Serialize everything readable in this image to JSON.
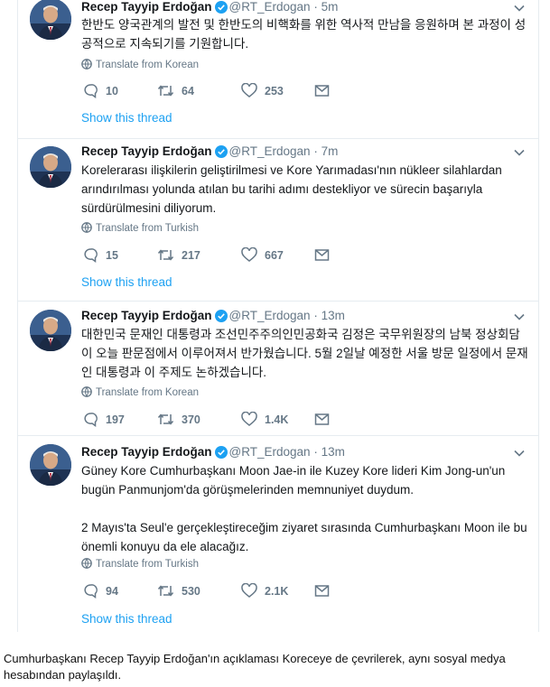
{
  "tweets": [
    {
      "name": "Recep Tayyip Erdoğan",
      "handle": "@RT_Erdogan",
      "separator": "·",
      "time": "5m",
      "paragraphs": [
        "한반도 양국관계의 발전 및 한반도의 비핵화를 위한 역사적 만남을 응원하며 본 과정이 성공적으로 지속되기를 기원합니다."
      ],
      "translate": "Translate from Korean",
      "replies": "10",
      "retweets": "64",
      "likes": "253",
      "show_thread": "Show this thread"
    },
    {
      "name": "Recep Tayyip Erdoğan",
      "handle": "@RT_Erdogan",
      "separator": "·",
      "time": "7m",
      "paragraphs": [
        "Korelerarası ilişkilerin geliştirilmesi ve Kore Yarımadası'nın nükleer silahlardan arındırılması yolunda atılan bu tarihi adımı destekliyor ve sürecin başarıyla sürdürülmesini diliyorum."
      ],
      "translate": "Translate from Turkish",
      "replies": "15",
      "retweets": "217",
      "likes": "667",
      "show_thread": "Show this thread"
    },
    {
      "name": "Recep Tayyip Erdoğan",
      "handle": "@RT_Erdogan",
      "separator": "·",
      "time": "13m",
      "paragraphs": [
        "대한민국 문재인 대통령과 조선민주주의인민공화국 김정은 국무위원장의 남북 정상회담이 오늘 판문점에서 이루어져서 반가웠습니다. 5월 2일날 예정한 서울 방문 일정에서 문재인 대통령과 이 주제도 논하겠습니다."
      ],
      "translate": "Translate from Korean",
      "replies": "197",
      "retweets": "370",
      "likes": "1.4K"
    },
    {
      "name": "Recep Tayyip Erdoğan",
      "handle": "@RT_Erdogan",
      "separator": "·",
      "time": "13m",
      "paragraphs": [
        "Güney Kore Cumhurbaşkanı Moon Jae-in ile Kuzey Kore lideri Kim Jong-un'un bugün Panmunjom'da görüşmelerinden memnuniyet duydum.",
        "2 Mayıs'ta Seul'e gerçekleştireceğim ziyaret sırasında Cumhurbaşkanı Moon ile bu önemli konuyu da ele alacağız."
      ],
      "translate": "Translate from Turkish",
      "replies": "94",
      "retweets": "530",
      "likes": "2.1K",
      "show_thread": "Show this thread"
    }
  ],
  "caption": "Cumhurbaşkanı Recep Tayyip  Erdoğan'ın açıklaması Koreceye de  çevrilerek, aynı sosyal medya hesabından paylaşıldı.",
  "colors": {
    "link": "#1da1f2",
    "muted": "#657786",
    "text": "#14171a",
    "border": "#e6ecf0"
  },
  "icons": [
    "verified-icon",
    "chevron-down-icon",
    "globe-icon",
    "reply-icon",
    "retweet-icon",
    "like-icon",
    "message-icon"
  ]
}
